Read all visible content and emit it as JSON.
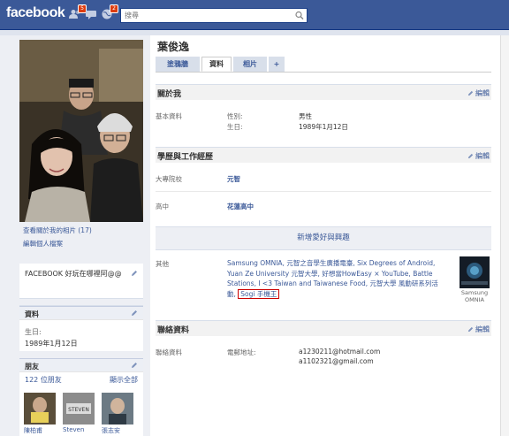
{
  "topbar": {
    "logo": "facebook",
    "friend_requests_badge": "5",
    "notifications_badge": "2",
    "search_placeholder": "搜尋",
    "brand_color": "#3b5998"
  },
  "profile": {
    "name": "葉俊逸",
    "tabs": [
      {
        "label": "塗鴉牆",
        "active": false
      },
      {
        "label": "資料",
        "active": true
      },
      {
        "label": "相片",
        "active": false
      },
      {
        "label": "+",
        "active": false
      }
    ]
  },
  "sidebar": {
    "photos_of_me_link": "查看關於我的相片 (17)",
    "edit_profile_link": "編輯個人檔案",
    "status_text": "FACEBOOK 好玩在哪裡阿@@",
    "info_box": {
      "title": "資料",
      "birthday_label": "生日:",
      "birthday_value": "1989年1月12日"
    },
    "friends_box": {
      "title": "朋友",
      "count": "122 位朋友",
      "see_all": "顯示全部",
      "friends": [
        {
          "name": "陳柏甫"
        },
        {
          "name": "Steven"
        },
        {
          "name": "張志安"
        }
      ]
    }
  },
  "about": {
    "title": "關於我",
    "edit": "編輯",
    "group_label": "基本資料",
    "gender_label": "性別:",
    "gender_value": "男性",
    "birthday_label": "生日:",
    "birthday_value": "1989年1月12日"
  },
  "education": {
    "title": "學歷與工作經歷",
    "edit": "編輯",
    "college_label": "大專院校",
    "college_value": "元智",
    "highschool_label": "高中",
    "highschool_value": "花蓮高中"
  },
  "interests": {
    "add_label": "新增愛好與興趣",
    "other_label": "其他",
    "other_text": "Samsung OMNIA, 元智之音學生廣播電臺, Six Degrees of Android, Yuan Ze University 元智大學, 好想當HowEasy × YouTube, Battle Stations, I <3 Taiwan and Taiwanese Food, 元智大學 風動研系列活動,",
    "highlighted_item": "Sogi 手機王",
    "samsung_caption": "Samsung OMNIA"
  },
  "contact": {
    "title": "聯絡資料",
    "edit": "編輯",
    "group_label": "聯絡資料",
    "email_label": "電郵地址:",
    "emails": [
      "a1230211@hotmail.com",
      "a1102321@gmail.com"
    ]
  }
}
